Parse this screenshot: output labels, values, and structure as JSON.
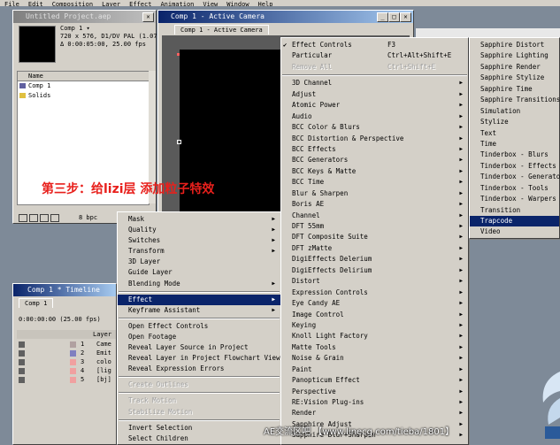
{
  "menubar": [
    "File",
    "Edit",
    "Composition",
    "Layer",
    "Effect",
    "Animation",
    "View",
    "Window",
    "Help"
  ],
  "project": {
    "title": "Untitled Project.aep",
    "info_line1": "Comp 1 ▾",
    "info_line2": "720 x 576, D1/DV PAL (1.07)",
    "info_line3": "Δ 0:00:05:00, 25.00 fps",
    "name_header": "Name",
    "items": [
      "Comp 1",
      "Solids"
    ],
    "bpc": "8 bpc"
  },
  "comp_window": {
    "title": "Comp 1 - Active Camera",
    "tab": "Comp 1 - Active Camera"
  },
  "timeline": {
    "title": "Comp 1 * Timeline",
    "tab": "Comp 1",
    "timecode": "0:00:00:00",
    "fps": "(25.00 fps)",
    "layer_header": "Layer",
    "layers": [
      {
        "num": "1",
        "name": "Came",
        "color": "#b0a0a0"
      },
      {
        "num": "2",
        "name": "Emit",
        "color": "#8080c0"
      },
      {
        "num": "3",
        "name": "colo",
        "color": "#f0a0a0"
      },
      {
        "num": "4",
        "name": "[lig",
        "color": "#f0a0a0"
      },
      {
        "num": "5",
        "name": "[bj]",
        "color": "#f0a0a0"
      }
    ]
  },
  "annotation": "第三步：给lizi层 添加粒子特效",
  "watermark": "AE交流区吧  【www.linecg.com/tieba/1801】",
  "layer_menu": {
    "items": [
      {
        "label": "Mask",
        "arrow": true
      },
      {
        "label": "Quality",
        "arrow": true
      },
      {
        "label": "Switches",
        "arrow": true
      },
      {
        "label": "Transform",
        "arrow": true
      },
      {
        "label": "3D Layer"
      },
      {
        "label": "Guide Layer"
      },
      {
        "label": "Blending Mode",
        "arrow": true
      },
      {
        "sep": true
      },
      {
        "label": "Effect",
        "arrow": true,
        "selected": true
      },
      {
        "label": "Keyframe Assistant",
        "arrow": true
      },
      {
        "sep": true
      },
      {
        "label": "Open Effect Controls"
      },
      {
        "label": "Open Footage"
      },
      {
        "label": "Reveal Layer Source in Project"
      },
      {
        "label": "Reveal Layer in Project Flowchart View"
      },
      {
        "label": "Reveal Expression Errors"
      },
      {
        "sep": true
      },
      {
        "label": "Create Outlines",
        "disabled": true
      },
      {
        "sep": true
      },
      {
        "label": "Track Motion",
        "disabled": true
      },
      {
        "label": "Stabilize Motion",
        "disabled": true
      },
      {
        "sep": true
      },
      {
        "label": "Invert Selection"
      },
      {
        "label": "Select Children"
      }
    ]
  },
  "effect_menu": {
    "items": [
      {
        "label": "Effect Controls",
        "shortcut": "F3",
        "checked": true
      },
      {
        "label": "Particular",
        "shortcut": "Ctrl+Alt+Shift+E"
      },
      {
        "label": "Remove All",
        "shortcut": "Ctrl+Shift+E",
        "disabled": true
      },
      {
        "sep": true
      },
      {
        "label": "3D Channel",
        "arrow": true
      },
      {
        "label": "Adjust",
        "arrow": true
      },
      {
        "label": "Atomic Power",
        "arrow": true
      },
      {
        "label": "Audio",
        "arrow": true
      },
      {
        "label": "BCC Color & Blurs",
        "arrow": true
      },
      {
        "label": "BCC Distortion & Perspective",
        "arrow": true
      },
      {
        "label": "BCC Effects",
        "arrow": true
      },
      {
        "label": "BCC Generators",
        "arrow": true
      },
      {
        "label": "BCC Keys & Matte",
        "arrow": true
      },
      {
        "label": "BCC Time",
        "arrow": true
      },
      {
        "label": "Blur & Sharpen",
        "arrow": true
      },
      {
        "label": "Boris AE",
        "arrow": true
      },
      {
        "label": "Channel",
        "arrow": true
      },
      {
        "label": "DFT 55mm",
        "arrow": true
      },
      {
        "label": "DFT Composite Suite",
        "arrow": true
      },
      {
        "label": "DFT zMatte",
        "arrow": true
      },
      {
        "label": "DigiEffects Delerium",
        "arrow": true
      },
      {
        "label": "DigiEffects Delirium",
        "arrow": true
      },
      {
        "label": "Distort",
        "arrow": true
      },
      {
        "label": "Expression Controls",
        "arrow": true
      },
      {
        "label": "Eye Candy AE",
        "arrow": true
      },
      {
        "label": "Image Control",
        "arrow": true
      },
      {
        "label": "Keying",
        "arrow": true
      },
      {
        "label": "Knoll Light Factory",
        "arrow": true
      },
      {
        "label": "Matte Tools",
        "arrow": true
      },
      {
        "label": "Noise & Grain",
        "arrow": true
      },
      {
        "label": "Paint",
        "arrow": true
      },
      {
        "label": "Panopticum Effect",
        "arrow": true
      },
      {
        "label": "Perspective",
        "arrow": true
      },
      {
        "label": "RE:Vision Plug-ins",
        "arrow": true
      },
      {
        "label": "Render",
        "arrow": true
      },
      {
        "label": "Sapphire Adjust",
        "arrow": true
      },
      {
        "label": "Sapphire Blur+Sharpen",
        "arrow": true
      }
    ]
  },
  "sub_menu": {
    "items": [
      {
        "label": "Sapphire Distort"
      },
      {
        "label": "Sapphire Lighting"
      },
      {
        "label": "Sapphire Render"
      },
      {
        "label": "Sapphire Stylize"
      },
      {
        "label": "Sapphire Time"
      },
      {
        "label": "Sapphire Transitions"
      },
      {
        "label": "Simulation"
      },
      {
        "label": "Stylize"
      },
      {
        "label": "Text"
      },
      {
        "label": "Time"
      },
      {
        "label": "Tinderbox - Blurs"
      },
      {
        "label": "Tinderbox - Effects"
      },
      {
        "label": "Tinderbox - Generators"
      },
      {
        "label": "Tinderbox - Tools"
      },
      {
        "label": "Tinderbox - Warpers"
      },
      {
        "label": "Transition"
      },
      {
        "label": "Trapcode",
        "selected": true
      },
      {
        "label": "Video"
      }
    ]
  },
  "colors": {
    "selection": "#0a246a",
    "annotation": "#e8201c",
    "watermark": "#ffffff"
  }
}
